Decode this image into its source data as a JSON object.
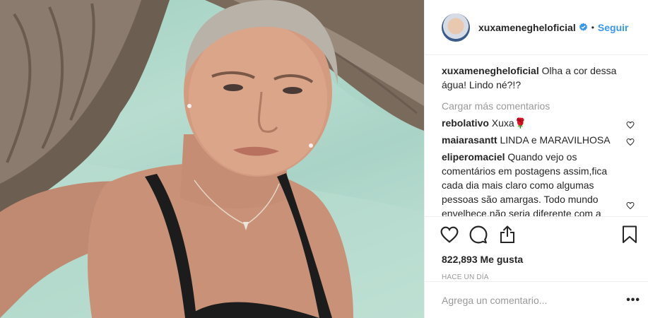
{
  "post": {
    "username": "xuxamenegheloficial",
    "follow_label": "Seguir",
    "separator": "•",
    "caption_user": "xuxamenegheloficial",
    "caption_text": "Olha a cor dessa água! Lindo né?!?",
    "load_more_label": "Cargar más comentarios",
    "comments": [
      {
        "user": "rebolativo",
        "text": "Xuxa🌹"
      },
      {
        "user": "maiarasantt",
        "text": "LINDA e MARAVILHOSA"
      },
      {
        "user": "eliperomaciel",
        "text": "Quando vejo os comentários em postagens assim,fica cada dia mais claro como algumas pessoas são amargas. Todo mundo envelhece,não seria diferente com a Xuxa. Mas o que me surpreende"
      }
    ],
    "likes": "822,893 Me gusta",
    "time": "HACE UN DÍA",
    "comment_placeholder": "Agrega un comentario...",
    "more_label": "•••"
  },
  "colors": {
    "accent": "#3897f0",
    "muted": "#999999",
    "text": "#262626",
    "border": "#efefef"
  },
  "icons": [
    "verified-icon",
    "heart-icon",
    "comment-icon",
    "share-icon",
    "bookmark-icon",
    "small-heart-icon"
  ]
}
